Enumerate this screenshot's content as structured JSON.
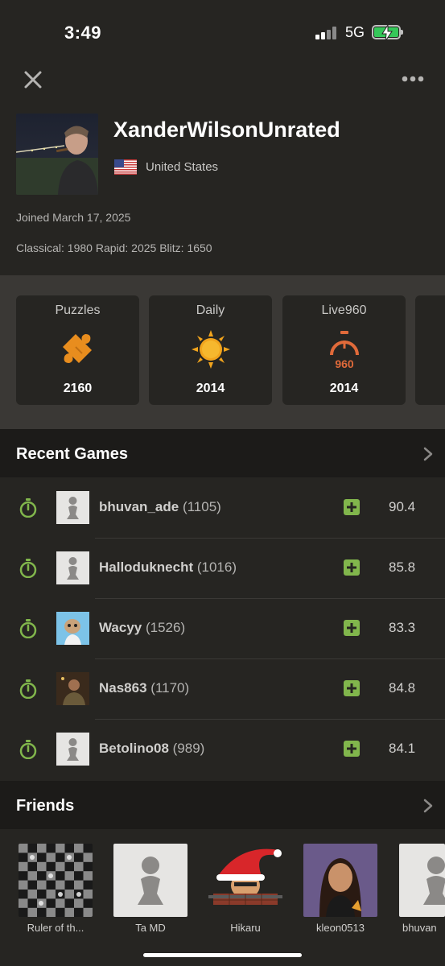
{
  "status_bar": {
    "time": "3:49",
    "network": "5G"
  },
  "profile": {
    "username": "XanderWilsonUnrated",
    "country": "United States",
    "joined": "Joined March 17, 2025",
    "ratings": "Classical: 1980 Rapid: 2025 Blitz: 1650"
  },
  "stats": [
    {
      "title": "Puzzles",
      "value": "2160",
      "icon": "puzzle-icon"
    },
    {
      "title": "Daily",
      "value": "2014",
      "icon": "sun-icon"
    },
    {
      "title": "Live960",
      "value": "2014",
      "icon": "stopwatch-960-icon"
    }
  ],
  "recent_games": {
    "title": "Recent Games",
    "games": [
      {
        "opponent": "bhuvan_ade",
        "rating": "(1105)",
        "accuracy": "90.4"
      },
      {
        "opponent": "Halloduknecht",
        "rating": "(1016)",
        "accuracy": "85.8"
      },
      {
        "opponent": "Wacyy",
        "rating": "(1526)",
        "accuracy": "83.3"
      },
      {
        "opponent": "Nas863",
        "rating": "(1170)",
        "accuracy": "84.8"
      },
      {
        "opponent": "Betolino08",
        "rating": "(989)",
        "accuracy": "84.1"
      }
    ]
  },
  "friends": {
    "title": "Friends",
    "items": [
      {
        "name": "Ruler of th..."
      },
      {
        "name": "Ta MD"
      },
      {
        "name": "Hikaru"
      },
      {
        "name": "kleon0513"
      },
      {
        "name": "bhuvan"
      }
    ]
  },
  "colors": {
    "accent_green": "#81b64c",
    "orange": "#e88d1e",
    "live960_orange": "#e06a3a"
  }
}
